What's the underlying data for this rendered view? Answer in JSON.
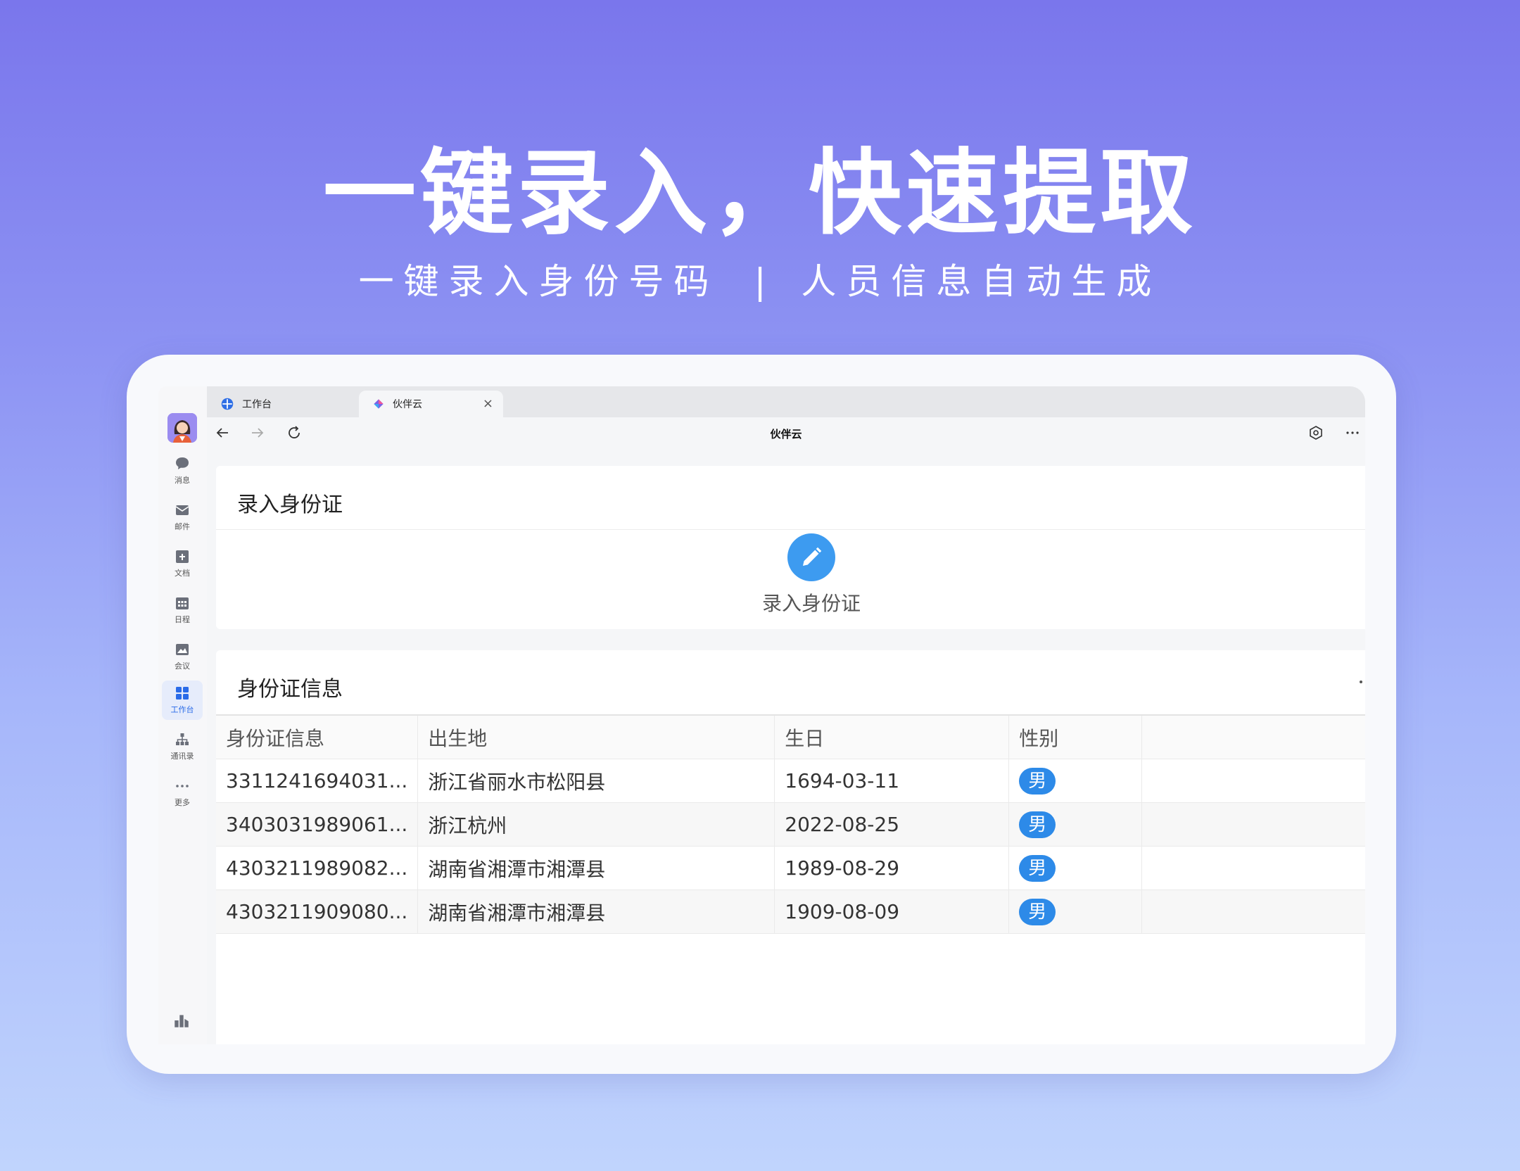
{
  "hero": {
    "headline": "一键录入，快速提取",
    "sub_left": "一键录入身份号码",
    "sub_sep": "|",
    "sub_right": "人员信息自动生成"
  },
  "sidebar": {
    "items": [
      {
        "label": "消息",
        "icon": "chat-icon"
      },
      {
        "label": "邮件",
        "icon": "mail-icon"
      },
      {
        "label": "文档",
        "icon": "document-icon"
      },
      {
        "label": "日程",
        "icon": "calendar-icon"
      },
      {
        "label": "会议",
        "icon": "meeting-icon"
      },
      {
        "label": "工作台",
        "icon": "workspace-icon",
        "active": true
      },
      {
        "label": "通讯录",
        "icon": "contacts-icon"
      },
      {
        "label": "更多",
        "icon": "more-icon"
      }
    ]
  },
  "browser": {
    "tabs": [
      {
        "label": "工作台"
      },
      {
        "label": "伙伴云",
        "close": "×"
      }
    ],
    "page_title": "伙伴云"
  },
  "entry_card": {
    "title": "录入身份证",
    "button_label": "录入身份证"
  },
  "info_card": {
    "title": "身份证信息",
    "columns": [
      "身份证信息",
      "出生地",
      "生日",
      "性别"
    ],
    "rows": [
      {
        "id": "3311241694031...",
        "birthplace": "浙江省丽水市松阳县",
        "birthday": "1694-03-11",
        "gender": "男"
      },
      {
        "id": "3403031989061...",
        "birthplace": "浙江杭州",
        "birthday": "2022-08-25",
        "gender": "男"
      },
      {
        "id": "4303211989082...",
        "birthplace": "湖南省湘潭市湘潭县",
        "birthday": "1989-08-29",
        "gender": "男"
      },
      {
        "id": "4303211909080...",
        "birthplace": "湖南省湘潭市湘潭县",
        "birthday": "1909-08-09",
        "gender": "男"
      }
    ]
  },
  "colors": {
    "accent": "#3d9bf0",
    "badge": "#2d8ae8",
    "active_nav": "#2a6be8"
  }
}
